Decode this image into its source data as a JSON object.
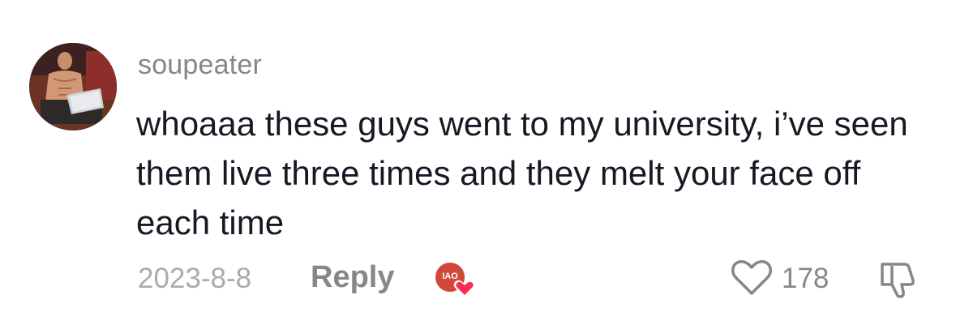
{
  "comment": {
    "username": "soupeater",
    "text": "whoaaa these guys went to my university, i’ve seen them live three times and they melt your face off each time",
    "date": "2023-8-8",
    "reply_label": "Reply",
    "creator_badge_text": "IAO",
    "like_count": "178"
  },
  "colors": {
    "text_primary": "#161823",
    "text_secondary": "#86878b",
    "date": "#aaabaf",
    "heart_badge": "#fe2c55",
    "creator_avatar_bg": "#d2473a"
  },
  "icons": {
    "like": "heart-outline-icon",
    "dislike": "thumbs-down-outline-icon",
    "creator_like": "heart-filled-icon"
  }
}
